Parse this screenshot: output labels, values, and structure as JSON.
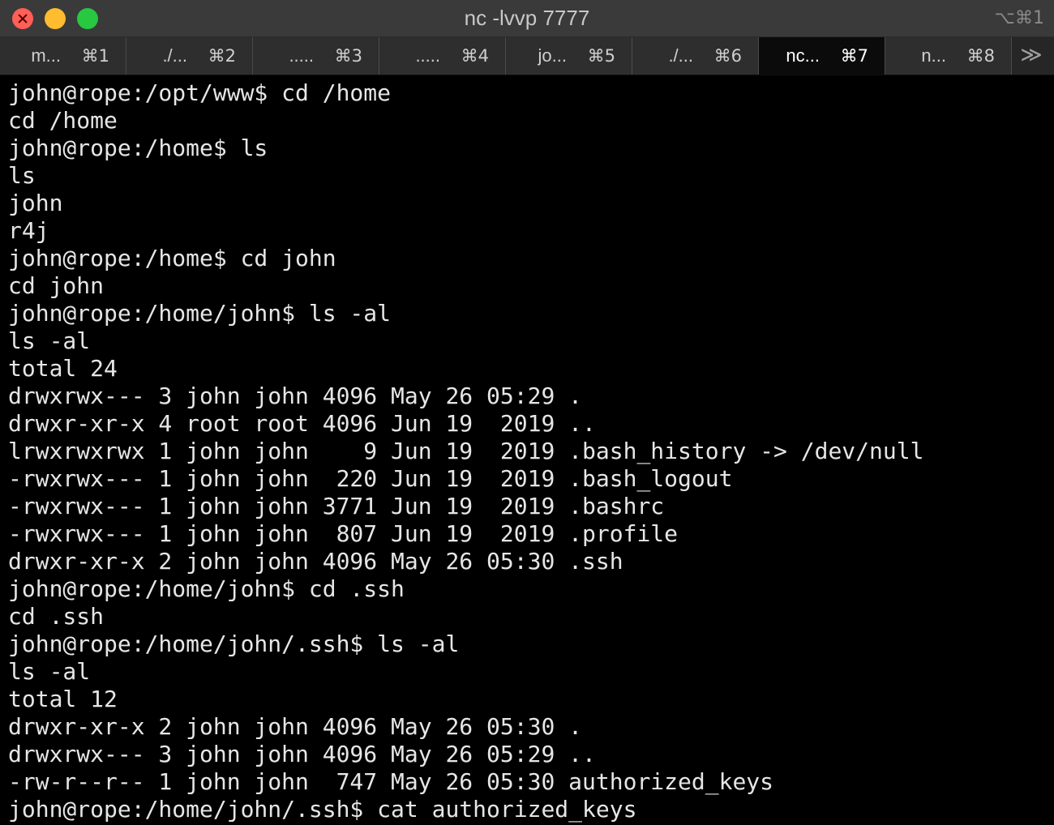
{
  "window": {
    "title": "nc -lvvp 7777",
    "shortcut": "⌥⌘1"
  },
  "tabs": [
    {
      "title": "m...",
      "key": "⌘1",
      "active": false
    },
    {
      "title": "./...",
      "key": "⌘2",
      "active": false
    },
    {
      "title": ".....",
      "key": "⌘3",
      "active": false
    },
    {
      "title": ".....",
      "key": "⌘4",
      "active": false
    },
    {
      "title": "jo...",
      "key": "⌘5",
      "active": false
    },
    {
      "title": "./...",
      "key": "⌘6",
      "active": false
    },
    {
      "title": "nc...",
      "key": "⌘7",
      "active": true
    },
    {
      "title": "n...",
      "key": "⌘8",
      "active": false
    }
  ],
  "tab_overflow": "≫",
  "terminal": {
    "lines": [
      "john@rope:/opt/www$ cd /home",
      "cd /home",
      "john@rope:/home$ ls",
      "ls",
      "john",
      "r4j",
      "john@rope:/home$ cd john",
      "cd john",
      "john@rope:/home/john$ ls -al",
      "ls -al",
      "total 24",
      "drwxrwx--- 3 john john 4096 May 26 05:29 .",
      "drwxr-xr-x 4 root root 4096 Jun 19  2019 ..",
      "lrwxrwxrwx 1 john john    9 Jun 19  2019 .bash_history -> /dev/null",
      "-rwxrwx--- 1 john john  220 Jun 19  2019 .bash_logout",
      "-rwxrwx--- 1 john john 3771 Jun 19  2019 .bashrc",
      "-rwxrwx--- 1 john john  807 Jun 19  2019 .profile",
      "drwxr-xr-x 2 john john 4096 May 26 05:30 .ssh",
      "john@rope:/home/john$ cd .ssh",
      "cd .ssh",
      "john@rope:/home/john/.ssh$ ls -al",
      "ls -al",
      "total 12",
      "drwxr-xr-x 2 john john 4096 May 26 05:30 .",
      "drwxrwx--- 3 john john 4096 May 26 05:29 ..",
      "-rw-r--r-- 1 john john  747 May 26 05:30 authorized_keys",
      "john@rope:/home/john/.ssh$ cat authorized_keys"
    ]
  }
}
